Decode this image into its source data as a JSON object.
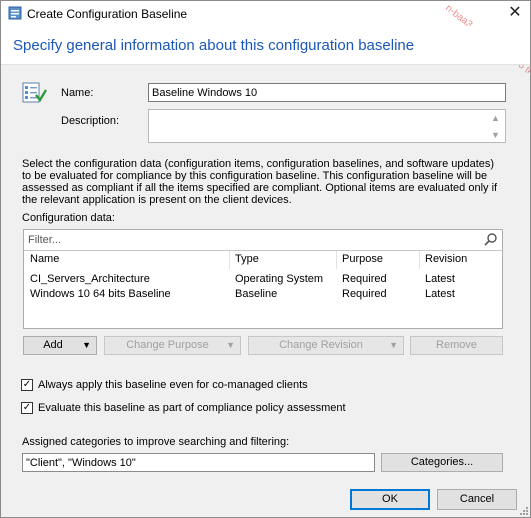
{
  "window": {
    "title": "Create Configuration Baseline",
    "close_glyph": "✕"
  },
  "header": {
    "heading": "Specify general information about this configuration baseline"
  },
  "general": {
    "name_label": "Name:",
    "name_value": "Baseline Windows 10",
    "description_label": "Description:",
    "description_value": ""
  },
  "info_text": "Select the configuration data (configuration items, configuration baselines, and software updates) to be evaluated for compliance by this configuration baseline. This configuration baseline will be assessed as compliant if all the items specified are compliant. Optional items are evaluated only if the relevant application is present on  the client devices.",
  "config_data": {
    "label": "Configuration data:",
    "filter_placeholder": "Filter...",
    "columns": [
      "Name",
      "Type",
      "Purpose",
      "Revision"
    ],
    "rows": [
      [
        "CI_Servers_Architecture",
        "Operating System",
        "Required",
        "Latest"
      ],
      [
        "Windows 10 64 bits Baseline",
        "Baseline",
        "Required",
        "Latest"
      ]
    ]
  },
  "actions": {
    "add": "Add",
    "change_purpose": "Change Purpose",
    "change_revision": "Change Revision",
    "remove": "Remove"
  },
  "options": {
    "always_apply": {
      "label": "Always apply this baseline even for co-managed clients",
      "checked": true
    },
    "evaluate_compliance": {
      "label": "Evaluate this baseline as part of compliance policy assessment",
      "checked": true
    }
  },
  "categories": {
    "label": "Assigned categories to improve searching and filtering:",
    "value": "\"Client\", \"Windows 10\"",
    "button": "Categories..."
  },
  "footer": {
    "ok": "OK",
    "cancel": "Cancel"
  },
  "watermark_text": "n-baa3-efdd3bd701c6 teste",
  "colors": {
    "heading": "#1a57b8",
    "dialog_bg": "#f0f0f0",
    "accent": "#0078d7",
    "watermark": "#e06a6a"
  },
  "icons": [
    "app-icon",
    "close-icon",
    "wizard-checklist-icon",
    "search-icon",
    "dropdown-arrow-icon",
    "checkbox-check-icon",
    "size-grip-icon"
  ]
}
